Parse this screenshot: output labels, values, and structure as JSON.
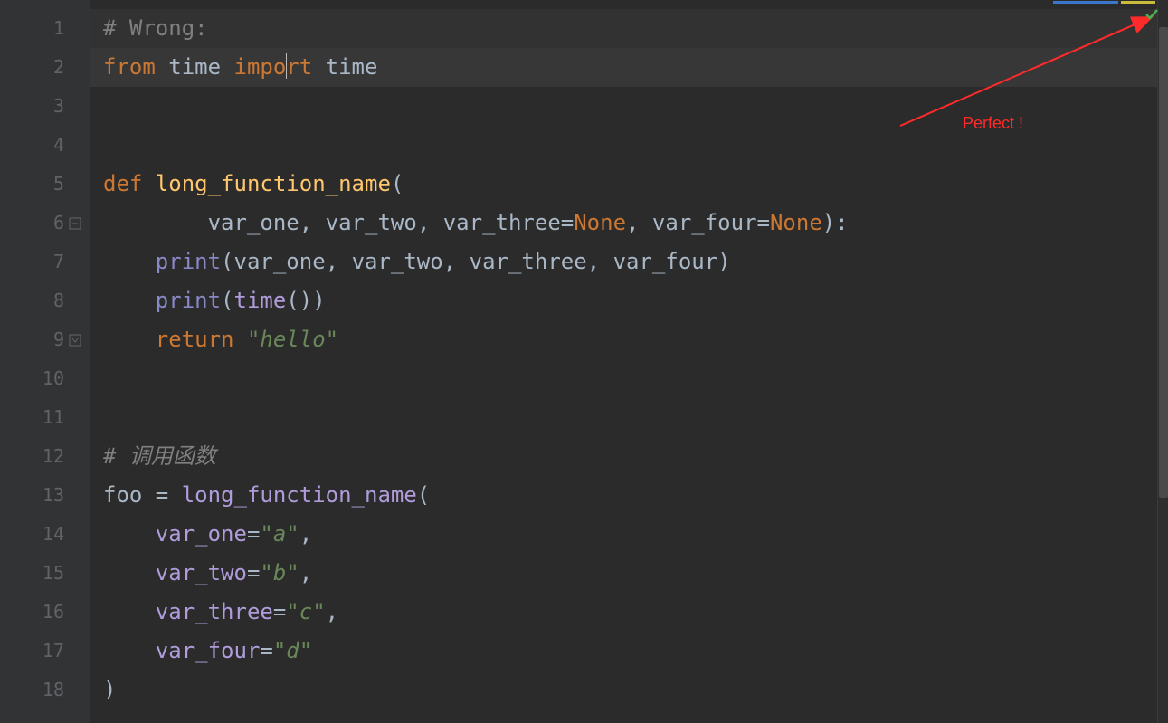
{
  "annotation": {
    "text": "Perfect !"
  },
  "status": {
    "check_icon": "check-icon"
  },
  "gutter": {
    "lines": [
      "1",
      "2",
      "3",
      "4",
      "5",
      "6",
      "7",
      "8",
      "9",
      "10",
      "11",
      "12",
      "13",
      "14",
      "15",
      "16",
      "17",
      "18"
    ]
  },
  "code": {
    "l1": {
      "hash": "# ",
      "comment": "Wrong:"
    },
    "l2": {
      "from": "from",
      "sp1": " ",
      "mod": "time",
      "sp2": " ",
      "imp_a": "impo",
      "imp_b": "rt",
      "sp3": " ",
      "name": "time"
    },
    "l5": {
      "def": "def",
      "sp": " ",
      "fn": "long_function_name",
      "open": "("
    },
    "l6": {
      "indent": "        ",
      "p1": "var_one",
      "c1": ", ",
      "p2": "var_two",
      "c2": ", ",
      "p3": "var_three",
      "eq1": "=",
      "none1": "None",
      "c3": ", ",
      "p4": "var_four",
      "eq2": "=",
      "none2": "None",
      "close": "):"
    },
    "l7": {
      "indent": "    ",
      "print": "print",
      "open": "(",
      "a1": "var_one",
      "c1": ", ",
      "a2": "var_two",
      "c2": ", ",
      "a3": "var_three",
      "c3": ", ",
      "a4": "var_four",
      "close": ")"
    },
    "l8": {
      "indent": "    ",
      "print": "print",
      "open": "(",
      "time": "time",
      "parens": "()",
      "close": ")"
    },
    "l9": {
      "indent": "    ",
      "ret": "return",
      "sp": " ",
      "str": "\"hello\""
    },
    "l12": {
      "hash": "# ",
      "comment": "调用函数"
    },
    "l13": {
      "var": "foo ",
      "eq": "= ",
      "fn": "long_function_name",
      "open": "("
    },
    "l14": {
      "indent": "    ",
      "kw": "var_one",
      "eq": "=",
      "str": "\"a\"",
      "comma": ","
    },
    "l15": {
      "indent": "    ",
      "kw": "var_two",
      "eq": "=",
      "str": "\"b\"",
      "comma": ","
    },
    "l16": {
      "indent": "    ",
      "kw": "var_three",
      "eq": "=",
      "str": "\"c\"",
      "comma": ","
    },
    "l17": {
      "indent": "    ",
      "kw": "var_four",
      "eq": "=",
      "str": "\"d\""
    },
    "l18": {
      "close": ")"
    }
  }
}
